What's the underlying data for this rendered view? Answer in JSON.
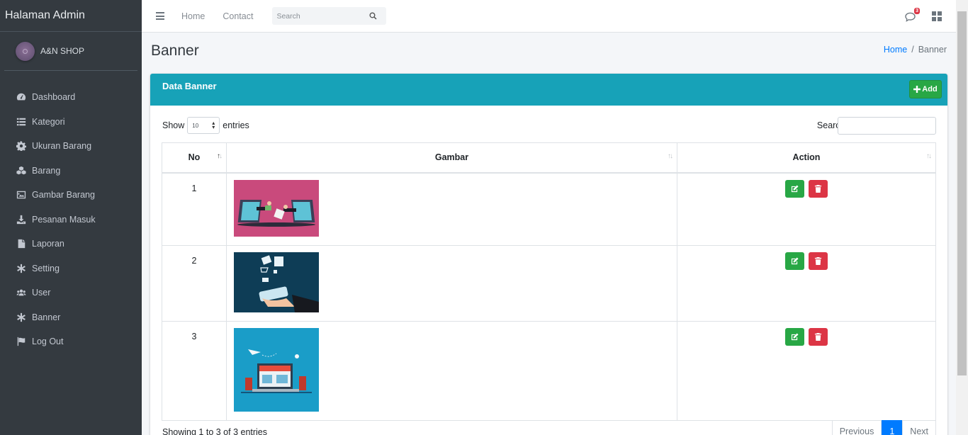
{
  "sidebar": {
    "brand": "Halaman Admin",
    "user": "A&N SHOP",
    "items": [
      {
        "label": "Dashboard",
        "icon": "tachometer-icon"
      },
      {
        "label": "Kategori",
        "icon": "list-icon"
      },
      {
        "label": "Ukuran Barang",
        "icon": "cog-icon"
      },
      {
        "label": "Barang",
        "icon": "cubes-icon"
      },
      {
        "label": "Gambar Barang",
        "icon": "image-icon"
      },
      {
        "label": "Pesanan Masuk",
        "icon": "download-icon"
      },
      {
        "label": "Laporan",
        "icon": "file-icon"
      },
      {
        "label": "Setting",
        "icon": "asterisk-icon"
      },
      {
        "label": "User",
        "icon": "users-icon"
      },
      {
        "label": "Banner",
        "icon": "asterisk-icon"
      },
      {
        "label": "Log Out",
        "icon": "flag-icon"
      }
    ]
  },
  "topbar": {
    "home": "Home",
    "contact": "Contact",
    "search_placeholder": "Search",
    "badge_count": "3"
  },
  "header": {
    "title": "Banner",
    "breadcrumb_home": "Home",
    "breadcrumb_sep": "/",
    "breadcrumb_current": "Banner"
  },
  "card": {
    "title": "Data Banner",
    "add_label": "Add",
    "show_label": "Show",
    "entries_value": "10",
    "entries_label": "entries",
    "search_label": "Search:",
    "columns": [
      "No",
      "Gambar",
      "Action"
    ],
    "rows": [
      {
        "no": "1",
        "image": "banner-image-online-payment"
      },
      {
        "no": "2",
        "image": "banner-image-mobile-shopping"
      },
      {
        "no": "3",
        "image": "banner-image-online-store"
      }
    ],
    "info": "Showing 1 to 3 of 3 entries",
    "pager": {
      "previous": "Previous",
      "current": "1",
      "next": "Next"
    }
  },
  "colors": {
    "sidebar": "#343a40",
    "header": "#17a2b8",
    "success": "#28a745",
    "danger": "#dc3545",
    "primary": "#007bff"
  }
}
